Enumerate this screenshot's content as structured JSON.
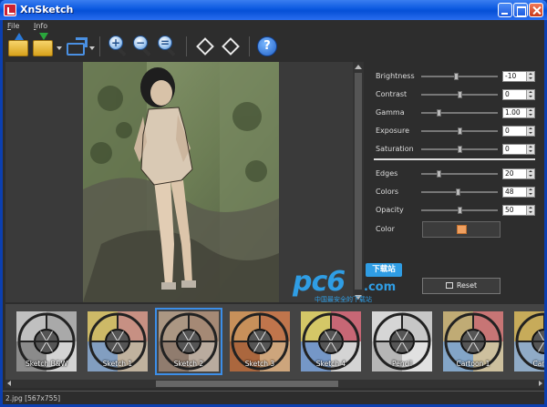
{
  "window": {
    "title": "XnSketch"
  },
  "menu": {
    "items": [
      {
        "label": "File"
      },
      {
        "label": "Info"
      }
    ]
  },
  "toolbar": {
    "icons": [
      "open-folder-icon",
      "save-folder-icon",
      "share-icon",
      "zoom-in-icon",
      "zoom-out-icon",
      "zoom-fit-icon",
      "rotate-left-icon",
      "rotate-right-icon",
      "help-icon"
    ],
    "help_label": "?"
  },
  "adjustments": {
    "brightness": {
      "label": "Brightness",
      "value": "-10",
      "fraction": 0.45
    },
    "contrast": {
      "label": "Contrast",
      "value": "0",
      "fraction": 0.5
    },
    "gamma": {
      "label": "Gamma",
      "value": "1.00",
      "fraction": 0.22
    },
    "exposure": {
      "label": "Exposure",
      "value": "0",
      "fraction": 0.5
    },
    "saturation": {
      "label": "Saturation",
      "value": "0",
      "fraction": 0.5
    },
    "edges": {
      "label": "Edges",
      "value": "20",
      "fraction": 0.22
    },
    "colors": {
      "label": "Colors",
      "value": "48",
      "fraction": 0.48
    },
    "opacity": {
      "label": "Opacity",
      "value": "50",
      "fraction": 0.5
    },
    "color": {
      "label": "Color",
      "swatch": "#f0a060"
    },
    "reset_label": "Reset"
  },
  "watermark": {
    "brand": "pc6",
    "tag": "下载站",
    "domain": ".com",
    "subtitle": "中国最安全的下载站"
  },
  "styles": [
    {
      "label": "Sketch B&W"
    },
    {
      "label": "Sketch 1"
    },
    {
      "label": "Sketch 2",
      "selected": true
    },
    {
      "label": "Sketch 3"
    },
    {
      "label": "Sketch 4"
    },
    {
      "label": "Pencil"
    },
    {
      "label": "Cartoon 1"
    },
    {
      "label": "Cartoo"
    }
  ],
  "status": {
    "text": "2.jpg [567x755]"
  },
  "colors": {
    "title_bar": "#0650d6",
    "panel_bg": "#2d2d2d",
    "selection": "#3c8ee8",
    "brand": "#2f9de4"
  }
}
